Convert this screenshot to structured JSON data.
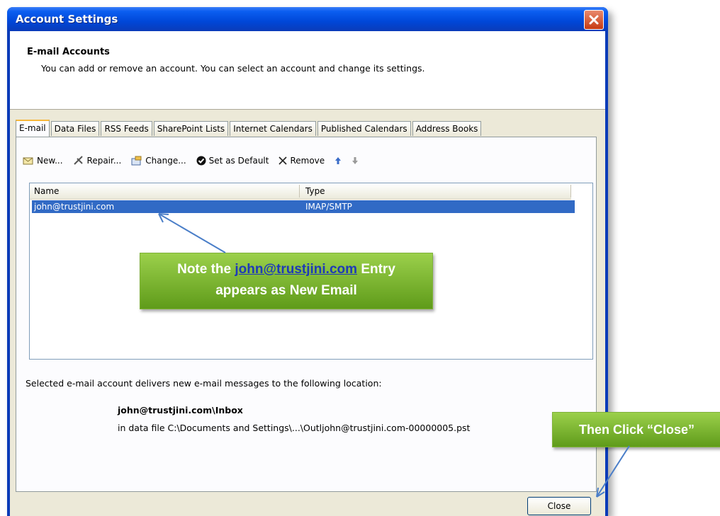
{
  "window": {
    "title": "Account Settings"
  },
  "header": {
    "title": "E-mail Accounts",
    "subtitle": "You can add or remove an account. You can select an account and change its settings."
  },
  "tabs": [
    {
      "label": "E-mail",
      "active": true
    },
    {
      "label": "Data Files"
    },
    {
      "label": "RSS Feeds"
    },
    {
      "label": "SharePoint Lists"
    },
    {
      "label": "Internet Calendars"
    },
    {
      "label": "Published Calendars"
    },
    {
      "label": "Address Books"
    }
  ],
  "toolbar": {
    "new_label": "New...",
    "repair_label": "Repair...",
    "change_label": "Change...",
    "default_label": "Set as Default",
    "remove_label": "Remove"
  },
  "list": {
    "columns": [
      "Name",
      "Type"
    ],
    "rows": [
      {
        "name": "john@trustjini.com",
        "type": "IMAP/SMTP",
        "selected": true
      }
    ]
  },
  "location": {
    "description": "Selected e-mail account delivers new e-mail messages to the following location:",
    "inbox": "john@trustjini.com\\Inbox",
    "file": "in data file C:\\Documents and Settings\\...\\Outljohn@trustjini.com-00000005.pst"
  },
  "buttons": {
    "close_label": "Close"
  },
  "callouts": {
    "note_prefix": "Note the",
    "note_link": "john@trustjini.com",
    "note_suffix": "Entry",
    "note_line2": "appears as New Email",
    "then_click": "Then Click “Close”"
  },
  "colors": {
    "accent": "#316ac5",
    "callout": "#72ac2a",
    "titlebar": "#0047d8"
  }
}
